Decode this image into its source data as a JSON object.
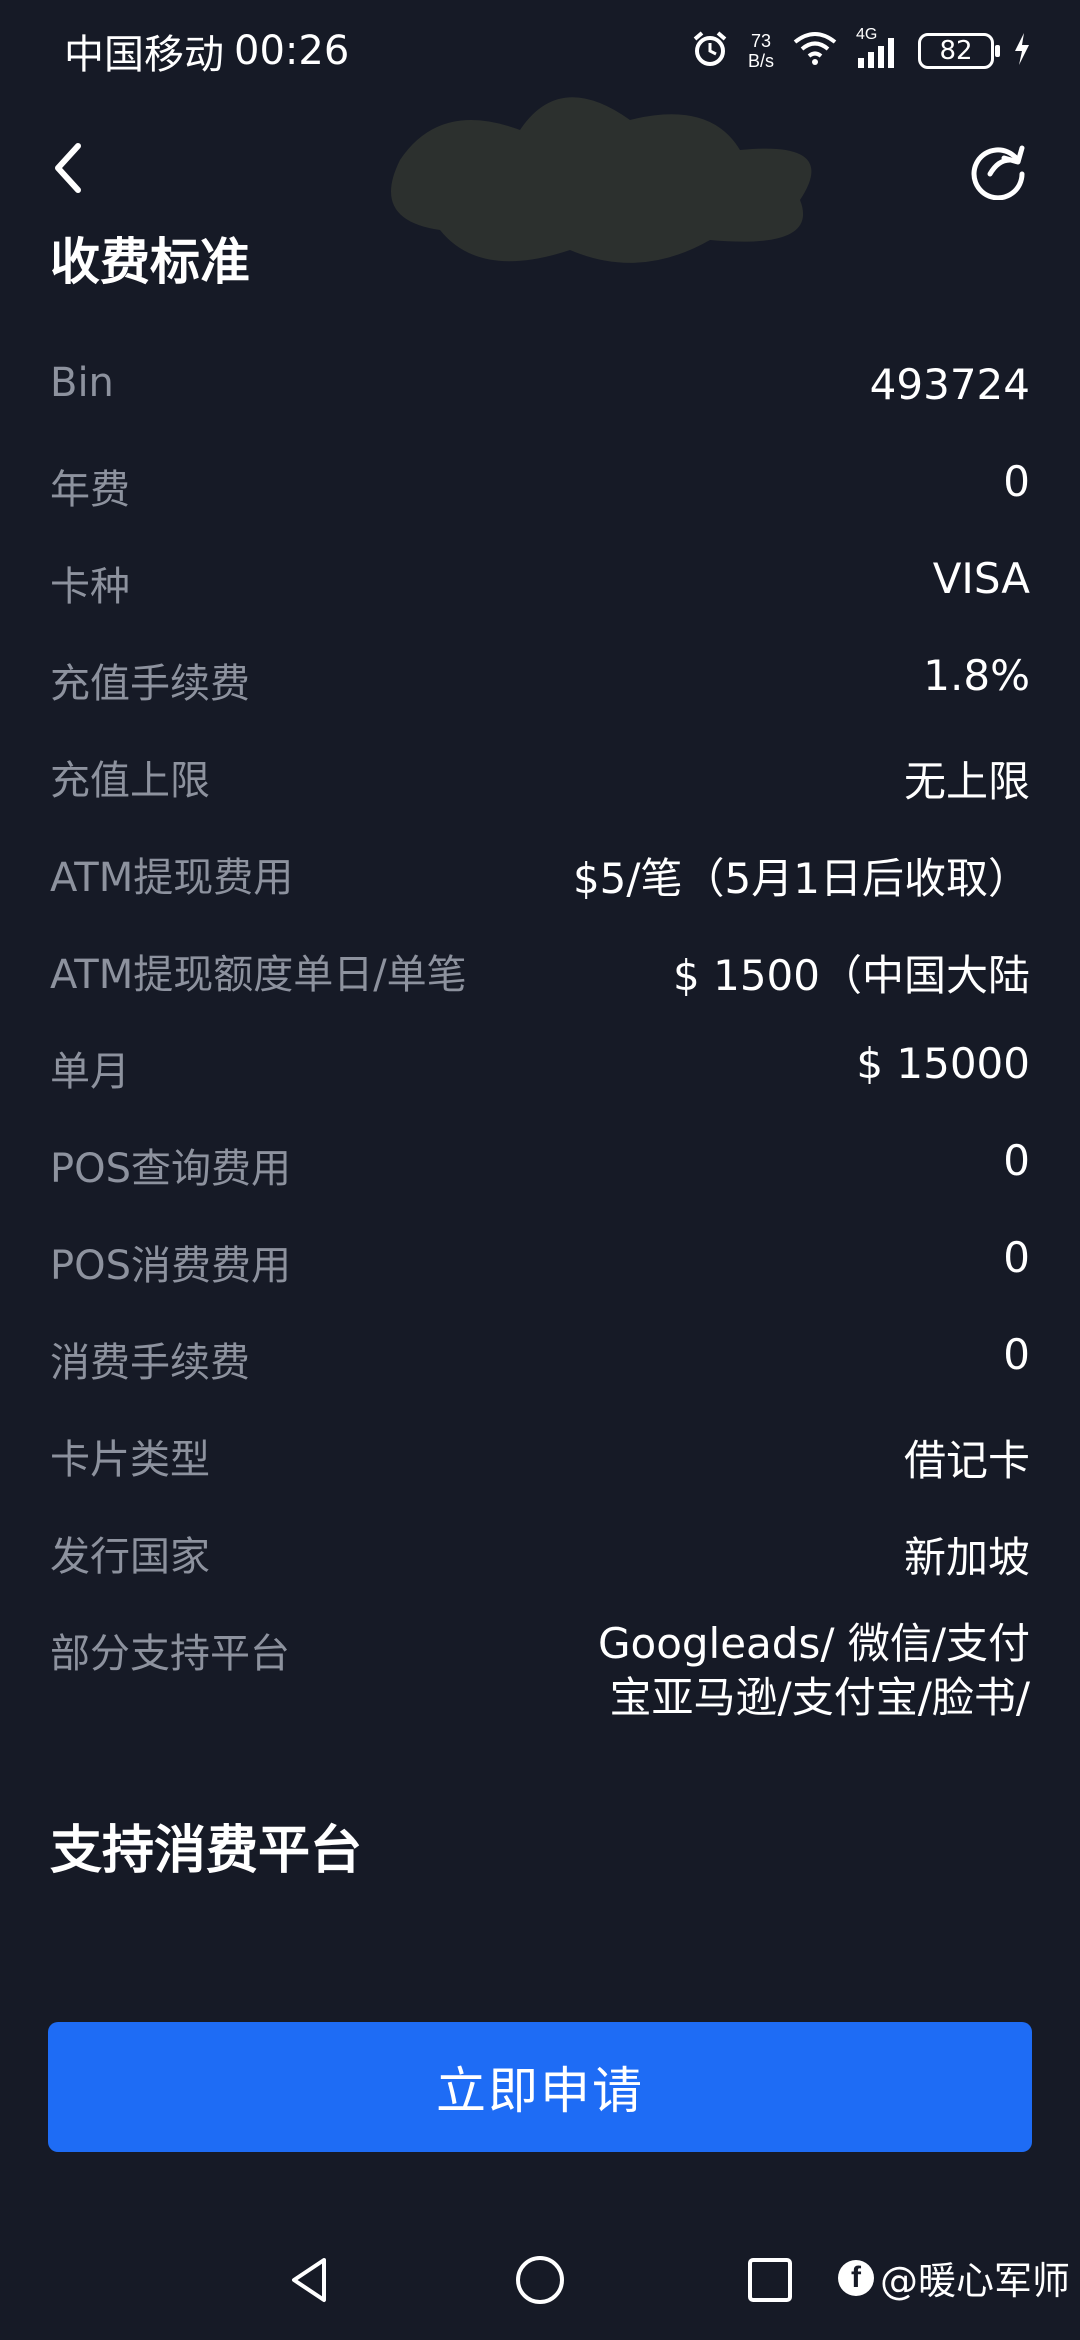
{
  "status_bar": {
    "carrier": "中国移动",
    "time": "00:26",
    "net_speed_value": "73",
    "net_speed_unit": "B/s",
    "signal_label": "4G",
    "battery": "82"
  },
  "header": {
    "title": "收费标准"
  },
  "fees": [
    {
      "label": "Bin",
      "value": "493724"
    },
    {
      "label": "年费",
      "value": "0"
    },
    {
      "label": "卡种",
      "value": "VISA"
    },
    {
      "label": "充值手续费",
      "value": "1.8%"
    },
    {
      "label": "充值上限",
      "value": "无上限"
    },
    {
      "label": "ATM提现费用",
      "value": "$5/笔（5月1日后收取）"
    },
    {
      "label": "ATM提现额度单日/单笔",
      "value": "$ 1500（中国大陆"
    },
    {
      "label": "单月",
      "value": "$ 15000"
    },
    {
      "label": "POS查询费用",
      "value": "0"
    },
    {
      "label": "POS消费费用",
      "value": "0"
    },
    {
      "label": "消费手续费",
      "value": "0"
    },
    {
      "label": "卡片类型",
      "value": "借记卡"
    },
    {
      "label": "发行国家",
      "value": "新加坡"
    },
    {
      "label": "部分支持平台",
      "value": "Googleads/ 微信/支付宝亚马逊/支付宝/脸书/"
    }
  ],
  "support_section": {
    "title": "支持消费平台"
  },
  "apply_button": {
    "label": "立即申请"
  },
  "watermark": {
    "text": "@暖心军师"
  },
  "colors": {
    "background": "#161a26",
    "label_gray": "#8d929e",
    "accent_blue": "#1e6cf5"
  },
  "icons": {
    "back": "chevron-left-icon",
    "refresh": "refresh-icon",
    "nav_back": "triangle-back-icon",
    "nav_home": "circle-home-icon",
    "nav_recents": "square-recents-icon"
  }
}
